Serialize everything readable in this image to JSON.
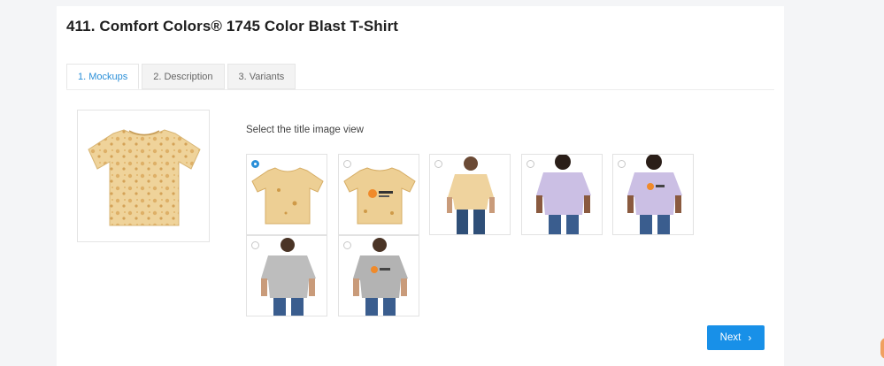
{
  "page": {
    "title": "411. Comfort Colors® 1745 Color Blast T-Shirt"
  },
  "tabs": [
    {
      "label": "1. Mockups",
      "active": true
    },
    {
      "label": "2. Description",
      "active": false
    },
    {
      "label": "3. Variants",
      "active": false
    }
  ],
  "mockups": {
    "section_label": "Select the title image view",
    "selected_index": 0,
    "views": [
      {
        "name": "tie-dye-tan-front-flat"
      },
      {
        "name": "tie-dye-tan-back-flat-with-logo"
      },
      {
        "name": "model-front-tan"
      },
      {
        "name": "model-front-lavender"
      },
      {
        "name": "model-back-lavender-with-logo"
      },
      {
        "name": "model-front-gray"
      },
      {
        "name": "model-back-gray-with-logo"
      }
    ]
  },
  "actions": {
    "next_label": "Next",
    "next_icon": "chevron-right-icon"
  },
  "colors": {
    "accent": "#1890e8",
    "tan": "#e8c98a",
    "lavender": "#c9bde3",
    "gray": "#b7b7b7"
  }
}
